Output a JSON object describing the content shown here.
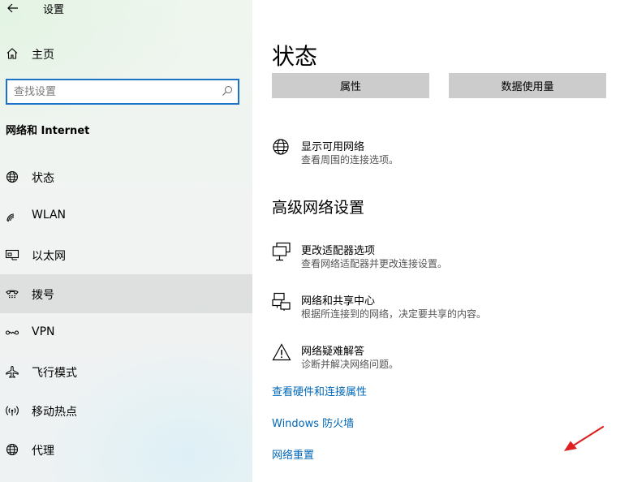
{
  "window": {
    "title": "设置"
  },
  "sidebar": {
    "home_label": "主页",
    "search_placeholder": "查找设置",
    "section_heading": "网络和 Internet",
    "items": [
      {
        "label": "状态",
        "icon": "globe-icon"
      },
      {
        "label": "WLAN",
        "icon": "wifi-icon"
      },
      {
        "label": "以太网",
        "icon": "ethernet-icon"
      },
      {
        "label": "拨号",
        "icon": "phone-icon"
      },
      {
        "label": "VPN",
        "icon": "vpn-icon"
      },
      {
        "label": "飞行模式",
        "icon": "airplane-icon"
      },
      {
        "label": "移动热点",
        "icon": "hotspot-icon"
      },
      {
        "label": "代理",
        "icon": "globe-icon"
      }
    ],
    "selected_item": "拨号"
  },
  "main": {
    "title": "状态",
    "buttons": {
      "properties": "属性",
      "data_usage": "数据使用量"
    },
    "show_networks": {
      "title": "显示可用网络",
      "desc": "查看周围的连接选项。"
    },
    "advanced_heading": "高级网络设置",
    "options": [
      {
        "title": "更改适配器选项",
        "desc": "查看网络适配器并更改连接设置。",
        "icon": "adapter-icon"
      },
      {
        "title": "网络和共享中心",
        "desc": "根据所连接到的网络，决定要共享的内容。",
        "icon": "sharing-center-icon"
      },
      {
        "title": "网络疑难解答",
        "desc": "诊断并解决网络问题。",
        "icon": "warning-icon"
      }
    ],
    "links": {
      "hardware": "查看硬件和连接属性",
      "firewall": "Windows 防火墙",
      "reset": "网络重置"
    }
  },
  "colors": {
    "accent": "#0067b8",
    "search_border": "#1a73c8",
    "annotation_arrow": "#e02020"
  }
}
